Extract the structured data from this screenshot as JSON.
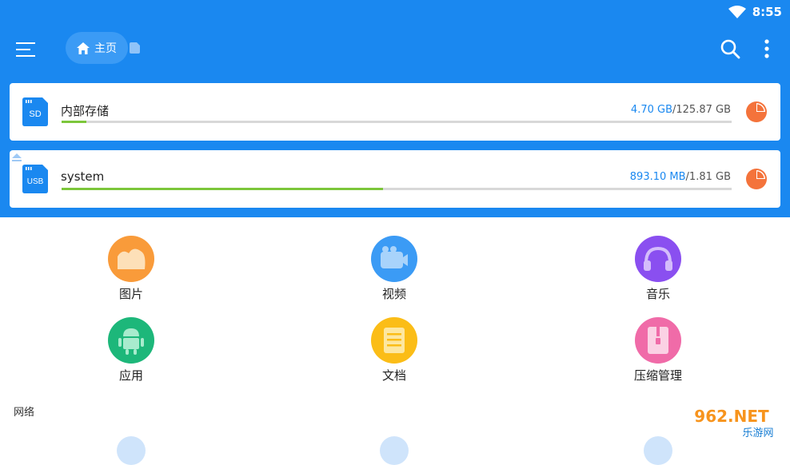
{
  "status_bar": {
    "time": "8:55",
    "wifi_icon": "wifi-icon"
  },
  "app_bar": {
    "menu_icon": "hamburger-menu-icon",
    "breadcrumb": {
      "home_label": "主页"
    },
    "search_icon": "search-icon",
    "more_icon": "more-vertical-icon"
  },
  "storage": [
    {
      "name": "内部存储",
      "badge": "SD",
      "used": "4.70 GB",
      "total": "/125.87 GB",
      "used_fraction": 0.037
    },
    {
      "name": "system",
      "badge": "USB",
      "used": "893.10 MB",
      "total": "/1.81 GB",
      "used_fraction": 0.48
    }
  ],
  "categories": [
    {
      "label": "图片",
      "color": "#f99b3a",
      "icon": "image-icon"
    },
    {
      "label": "视频",
      "color": "#3b9bf5",
      "icon": "video-icon"
    },
    {
      "label": "音乐",
      "color": "#8a4ff0",
      "icon": "music-icon"
    },
    {
      "label": "应用",
      "color": "#1db77a",
      "icon": "android-icon"
    },
    {
      "label": "文档",
      "color": "#fbbd17",
      "icon": "document-icon"
    },
    {
      "label": "压缩管理",
      "color": "#f06ba8",
      "icon": "archive-icon"
    }
  ],
  "network_section": {
    "label": "网络"
  },
  "watermark": {
    "text_top": "962.NET",
    "text_bottom": "乐游网"
  },
  "colors": {
    "primary": "#1a88f0",
    "progress": "#7cc63b",
    "pie": "#f4733b"
  }
}
